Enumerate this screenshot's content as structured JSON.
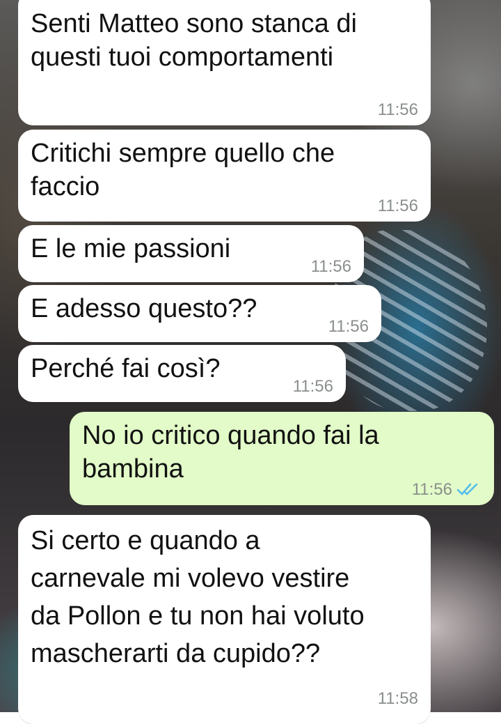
{
  "messages": [
    {
      "direction": "in",
      "text": "Senti Matteo sono stanca di\nquesti tuoi comportamenti",
      "time": "11:56"
    },
    {
      "direction": "in",
      "text": "Critichi sempre quello che\nfaccio",
      "time": "11:56"
    },
    {
      "direction": "in",
      "text": "E le mie passioni",
      "time": "11:56"
    },
    {
      "direction": "in",
      "text": "E adesso questo??",
      "time": "11:56"
    },
    {
      "direction": "in",
      "text": "Perché fai così?",
      "time": "11:56"
    },
    {
      "direction": "out",
      "text": "No io critico quando fai la\nbambina",
      "time": "11:56",
      "status": "read",
      "status_icon": "double-check-icon"
    },
    {
      "direction": "in",
      "text": "Si certo e quando a\ncarnevale mi volevo vestire\nda Pollon e tu non hai voluto\nmascherarti da cupido??",
      "time": "11:58"
    }
  ],
  "colors": {
    "incoming_bubble": "#ffffff",
    "outgoing_bubble": "#e2fbc8",
    "read_ticks": "#53bdeb",
    "timestamp": "#8a8f8c"
  }
}
